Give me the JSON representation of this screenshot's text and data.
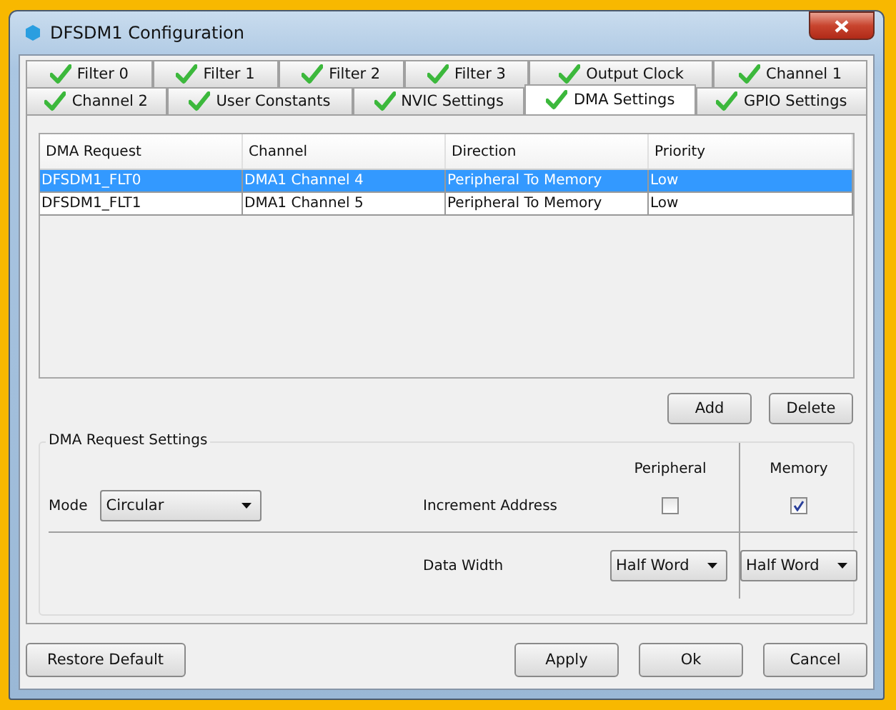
{
  "window": {
    "title": "DFSDM1 Configuration"
  },
  "tab_rows": [
    [
      {
        "label": "Filter 0",
        "valid": true,
        "selected": false
      },
      {
        "label": "Filter 1",
        "valid": true,
        "selected": false
      },
      {
        "label": "Filter 2",
        "valid": true,
        "selected": false
      },
      {
        "label": "Filter 3",
        "valid": true,
        "selected": false
      },
      {
        "label": "Output Clock",
        "valid": true,
        "selected": false
      },
      {
        "label": "Channel 1",
        "valid": true,
        "selected": false
      }
    ],
    [
      {
        "label": "Channel 2",
        "valid": true,
        "selected": false
      },
      {
        "label": "User Constants",
        "valid": true,
        "selected": false
      },
      {
        "label": "NVIC Settings",
        "valid": true,
        "selected": false
      },
      {
        "label": "DMA Settings",
        "valid": true,
        "selected": true
      },
      {
        "label": "GPIO Settings",
        "valid": true,
        "selected": false
      }
    ]
  ],
  "dma_table": {
    "columns": [
      "DMA Request",
      "Channel",
      "Direction",
      "Priority"
    ],
    "rows": [
      {
        "cells": [
          "DFSDM1_FLT0",
          "DMA1 Channel 4",
          "Peripheral To Memory",
          "Low"
        ],
        "selected": true
      },
      {
        "cells": [
          "DFSDM1_FLT1",
          "DMA1 Channel 5",
          "Peripheral To Memory",
          "Low"
        ],
        "selected": false
      }
    ]
  },
  "table_buttons": [
    "Add",
    "Delete"
  ],
  "request_settings": {
    "title": "DMA Request Settings",
    "mode": {
      "label": "Mode",
      "value": "Circular"
    },
    "column_headers": [
      "Peripheral",
      "Memory"
    ],
    "increment_address": {
      "label": "Increment Address",
      "peripheral_checked": false,
      "memory_checked": true
    },
    "data_width": {
      "label": "Data Width",
      "peripheral": "Half Word",
      "memory": "Half Word"
    }
  },
  "footer": {
    "left": "Restore Default",
    "right": [
      "Apply",
      "Ok",
      "Cancel"
    ]
  }
}
